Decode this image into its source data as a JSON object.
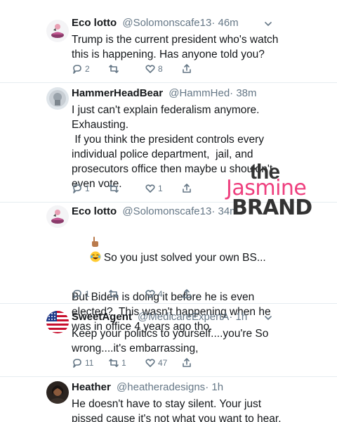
{
  "tweets": [
    {
      "name": "Eco lotto",
      "handle": "@Solomonscafe13",
      "time": "· 46m",
      "text": "Trump is the current president who's watch\nthis is happening. Has anyone told you?",
      "replies": "2",
      "retweets": "",
      "likes": "8"
    },
    {
      "name": "HammerHeadBear",
      "handle": "@HammHed",
      "time": "· 38m",
      "text": "I just can't explain federalism anymore.\nExhausting.\n If you think the president controls every\nindividual police department,  jail, and\nprosecutors office then maybe u shouldn't\neven vote.",
      "replies": "1",
      "retweets": "",
      "likes": "1"
    },
    {
      "name": "Eco lotto",
      "handle": "@Solomonscafe13",
      "time": "· 34m",
      "text_line1": "So you just solved your own BS...",
      "text": "But Biden is doing it before he is even\nelected?  This wasn't happening when he\nwas in office 4 years ago tho.",
      "replies": "1",
      "retweets": "",
      "likes": "4"
    },
    {
      "name": "SweetAgent",
      "handle": "@MedicareExpertA",
      "time": "· 1h",
      "text": "Keep your politics to yourself....you're So\nwrong....it's embarrassing,",
      "replies": "11",
      "retweets": "1",
      "likes": "47"
    },
    {
      "name": "Heather",
      "handle": "@heatheradesigns",
      "time": "· 1h",
      "text": "He doesn't have to stay silent. Your just\npissed cause it's not what you want to hear."
    }
  ],
  "watermark": {
    "line1": "the",
    "line2": "Jasmine",
    "line3": "BRAND"
  },
  "icons": {
    "reply": "reply-icon",
    "retweet": "retweet-icon",
    "like": "heart-icon",
    "share": "share-icon",
    "more": "chevron-down-icon"
  },
  "colors": {
    "text": "#14171a",
    "secondary": "#657786",
    "divider": "#e6ecf0",
    "brand_pink": "#ee3f7e"
  }
}
